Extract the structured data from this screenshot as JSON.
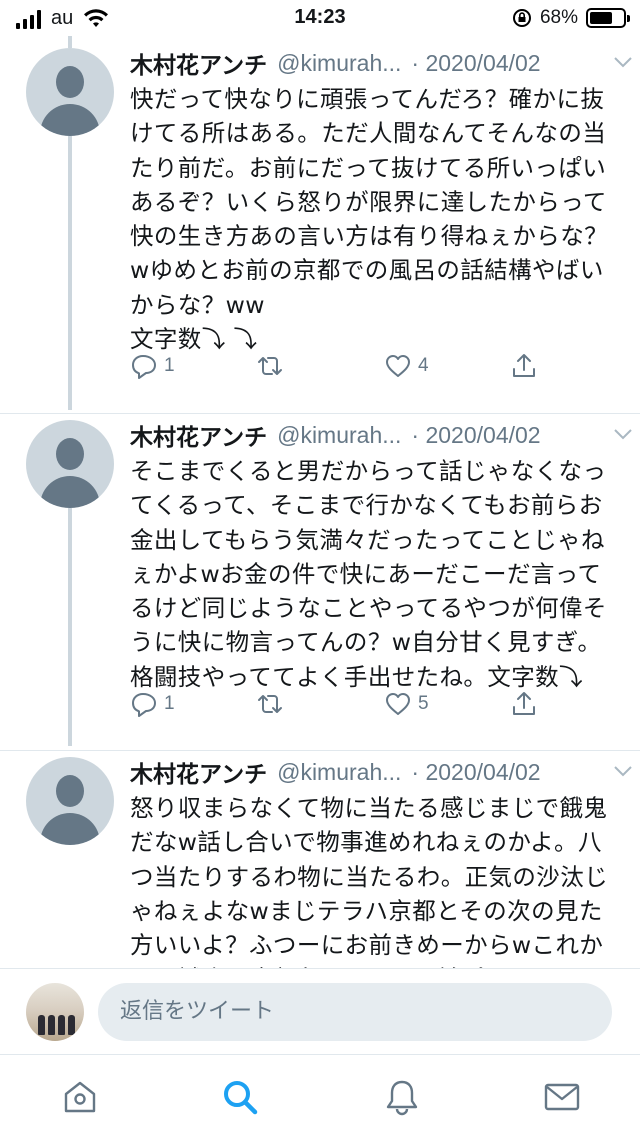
{
  "status_bar": {
    "carrier": "au",
    "time": "14:23",
    "battery": "68%",
    "battery_level": 0.68
  },
  "tweets": [
    {
      "name": "木村花アンチ",
      "handle": "@kimurah...",
      "date": "· 2020/04/02",
      "text": "快だって快なりに頑張ってんだろ？確かに抜けてる所はある。ただ人間なんてそんなの当たり前だ。お前にだって抜けてる所いっぱいあるぞ？いくら怒りが限界に達したからって快の生き方あの言い方は有り得ねぇからな？wゆめとお前の京都での風呂の話結構やばいからな？ww\n文字数⤵ ⤵",
      "replies": "1",
      "retweets": "",
      "likes": "4"
    },
    {
      "name": "木村花アンチ",
      "handle": "@kimurah...",
      "date": "· 2020/04/02",
      "text": "そこまでくると男だからって話じゃなくなってくるって、そこまで行かなくてもお前らお金出してもらう気満々だったってことじゃねぇかよwお金の件で快にあーだこーだ言ってるけど同じようなことやってるやつが何偉そうに快に物言ってんの？w自分甘く見すぎ。格闘技やっててよく手出せたね。文字数⤵",
      "replies": "1",
      "retweets": "",
      "likes": "5"
    },
    {
      "name": "木村花アンチ",
      "handle": "@kimurah...",
      "date": "· 2020/04/02",
      "text": "怒り収まらなくて物に当たる感じまじで餓鬼だなw話し合いで物事進めれねぇのかよ。八つ当たりするわ物に当たるわ。正気の沙汰じゃねぇよなwまじテラハ京都とその次の見た方いいよ？ふつーにお前きめーからwこれからの試合も全部負けるやwお前プロレスラー",
      "replies": "",
      "retweets": "",
      "likes": ""
    }
  ],
  "reply_bar": {
    "placeholder": "返信をツイート"
  },
  "tab_bar": {
    "items": [
      "home-icon",
      "search-icon",
      "notifications-icon",
      "messages-icon"
    ],
    "active": "search-icon"
  },
  "colors": {
    "accent": "#1da1f2",
    "secondary_text": "#657786",
    "thread_line": "#ccd6dd",
    "input_bg": "#e6ecf0"
  }
}
